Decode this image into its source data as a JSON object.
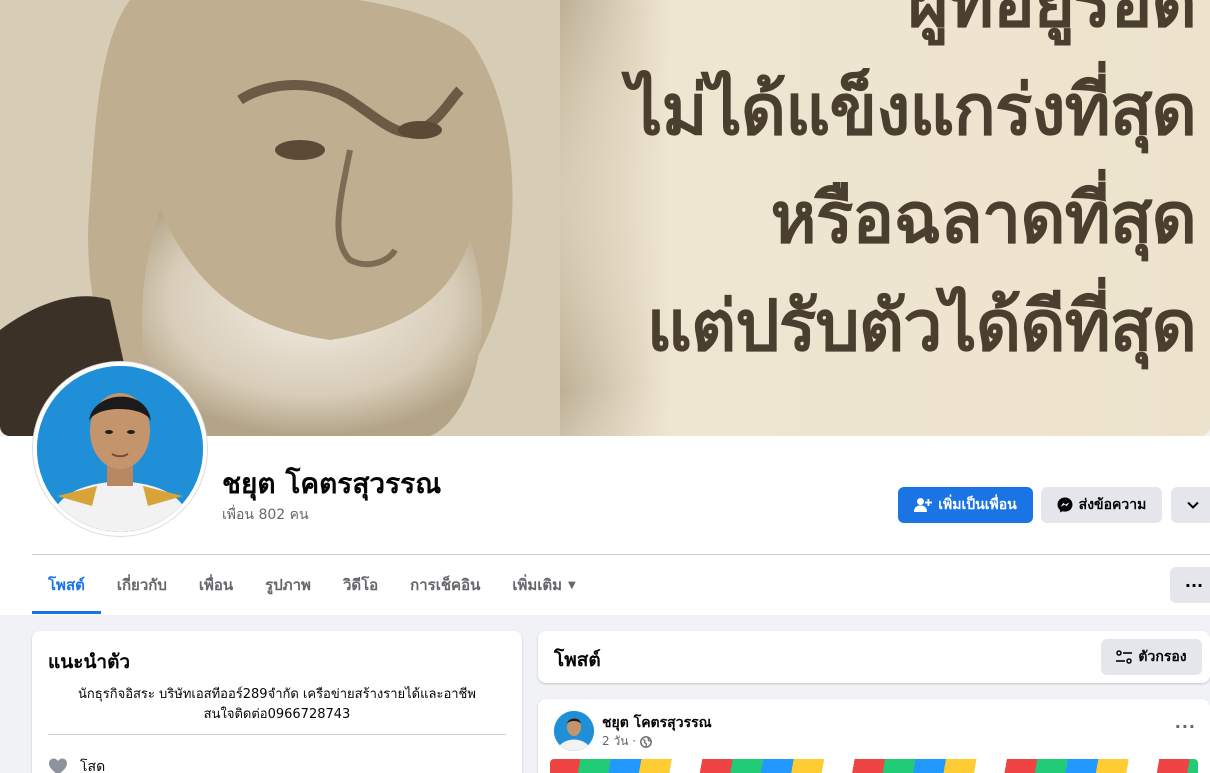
{
  "cover": {
    "quote_lines": [
      "ผู้ที่อยู่รอด",
      "ไม่ได้แข็งแกร่งที่สุด",
      "หรือฉลาดที่สุด",
      "แต่ปรับตัวได้ดีที่สุด"
    ]
  },
  "profile": {
    "name": "ชยุต โคตรสุวรรณ",
    "friends": "เพื่อน 802 คน"
  },
  "actions": {
    "add_friend": "เพิ่มเป็นเพื่อน",
    "message": "ส่งข้อความ"
  },
  "tabs": [
    {
      "label": "โพสต์"
    },
    {
      "label": "เกี่ยวกับ"
    },
    {
      "label": "เพื่อน"
    },
    {
      "label": "รูปภาพ"
    },
    {
      "label": "วิดีโอ"
    },
    {
      "label": "การเช็คอิน"
    },
    {
      "label": "เพิ่มเติม"
    }
  ],
  "intro": {
    "title": "แนะนำตัว",
    "bio_line1": "นักธุรกิจอิสระ บริษัทเอสทีออร์289จำกัด เครือข่ายสร้างรายได้และอาชีพ",
    "bio_line2": "สนใจติดต่อ0966728743",
    "relationship": "โสด"
  },
  "posts": {
    "title": "โพสต์",
    "filter_label": "ตัวกรอง"
  },
  "post": {
    "author": "ชยุต โคตรสุวรรณ",
    "time": "2 วัน ·"
  },
  "colors": {
    "accent": "#1b74e4",
    "button_gray": "#e4e6eb",
    "background": "#f0f2f5"
  }
}
